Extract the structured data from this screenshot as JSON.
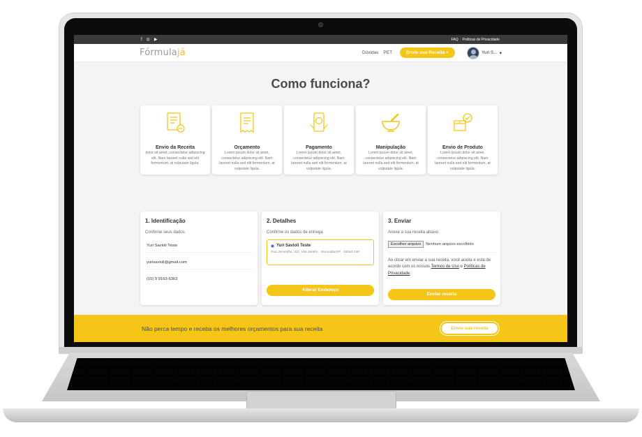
{
  "topbar": {
    "social": [
      "f",
      "◎",
      "▶"
    ],
    "links": [
      "FAQ",
      "Políticas de Privacidade"
    ]
  },
  "nav": {
    "logo_part1": "Fórmula",
    "logo_part2": "já",
    "links": [
      "Dúvidas",
      "PET"
    ],
    "cta_label": "Envie sua Receita +",
    "user_name": "Yuri S...",
    "user_caret": "▾"
  },
  "page_title": "Como funciona?",
  "steps": [
    {
      "icon": "prescription-icon",
      "title": "Envio da Receita",
      "desc": "dolor sit amet, consectetur adipiscing elit. Nam laoreet nulla sed elit fermentum, at vulputate ligula."
    },
    {
      "icon": "receipt-icon",
      "title": "Orçamento",
      "desc": "Lorem ipsum dolor sit amet, consectetur adipiscing elit. Nam laoreet nulla sed elit fermentum, at vulputate ligula."
    },
    {
      "icon": "mobile-payment-icon",
      "title": "Pagamento",
      "desc": "Lorem ipsum dolor sit amet, consectetur adipiscing elit. Nam laoreet nulla sed elit fermentum, at vulputate ligula."
    },
    {
      "icon": "mortar-pestle-icon",
      "title": "Manipulação",
      "desc": "Lorem ipsum dolor sit amet, consectetur adipiscing elit. Nam laoreet nulla sed elit fermentum, at vulputate ligula."
    },
    {
      "icon": "delivery-box-icon",
      "title": "Envio de Produto",
      "desc": "Lorem ipsum dolor sit amet, consectetur adipiscing elit. Nam laoreet nulla sed elit fermentum, at vulputate ligula."
    }
  ],
  "identificacao": {
    "title": "1. Identificação",
    "subtitle": "Confirme seus dados",
    "name": "Yuri Savioli Teste",
    "email": "yurisavioli@gmail.com",
    "phone": "(15) 9 9163-6363"
  },
  "detalhes": {
    "title": "2. Detalhes",
    "subtitle": "Confirme os dados de entrega",
    "address_name": "Yuri Savioli Teste",
    "address_line": "Rua Jocenilho, 321, Vila Jardim - Sorocaba/SP - 18044-150",
    "button": "Alterar Endereço"
  },
  "enviar": {
    "title": "3. Enviar",
    "subtitle": "Anexe a sua receita abaixo",
    "file_button": "Escolher arquivo",
    "file_status": "Nenhum arquivo escolhido",
    "terms_text": "Ao clicar em enviar a sua receita, você aceita e está de acordo com os nossos",
    "terms_link": "Termos de Uso",
    "terms_and": "e",
    "privacy_link": "Políticas de Privacidade",
    "terms_end": ".",
    "button": "Enviar receita"
  },
  "footer": {
    "text": "Não perca tempo e receba os melhores orçamentos para sua receita",
    "button": "Envio sua receita"
  },
  "colors": {
    "accent": "#f5c518",
    "topbar": "#3a3a3a",
    "background": "#f4f4f6"
  }
}
